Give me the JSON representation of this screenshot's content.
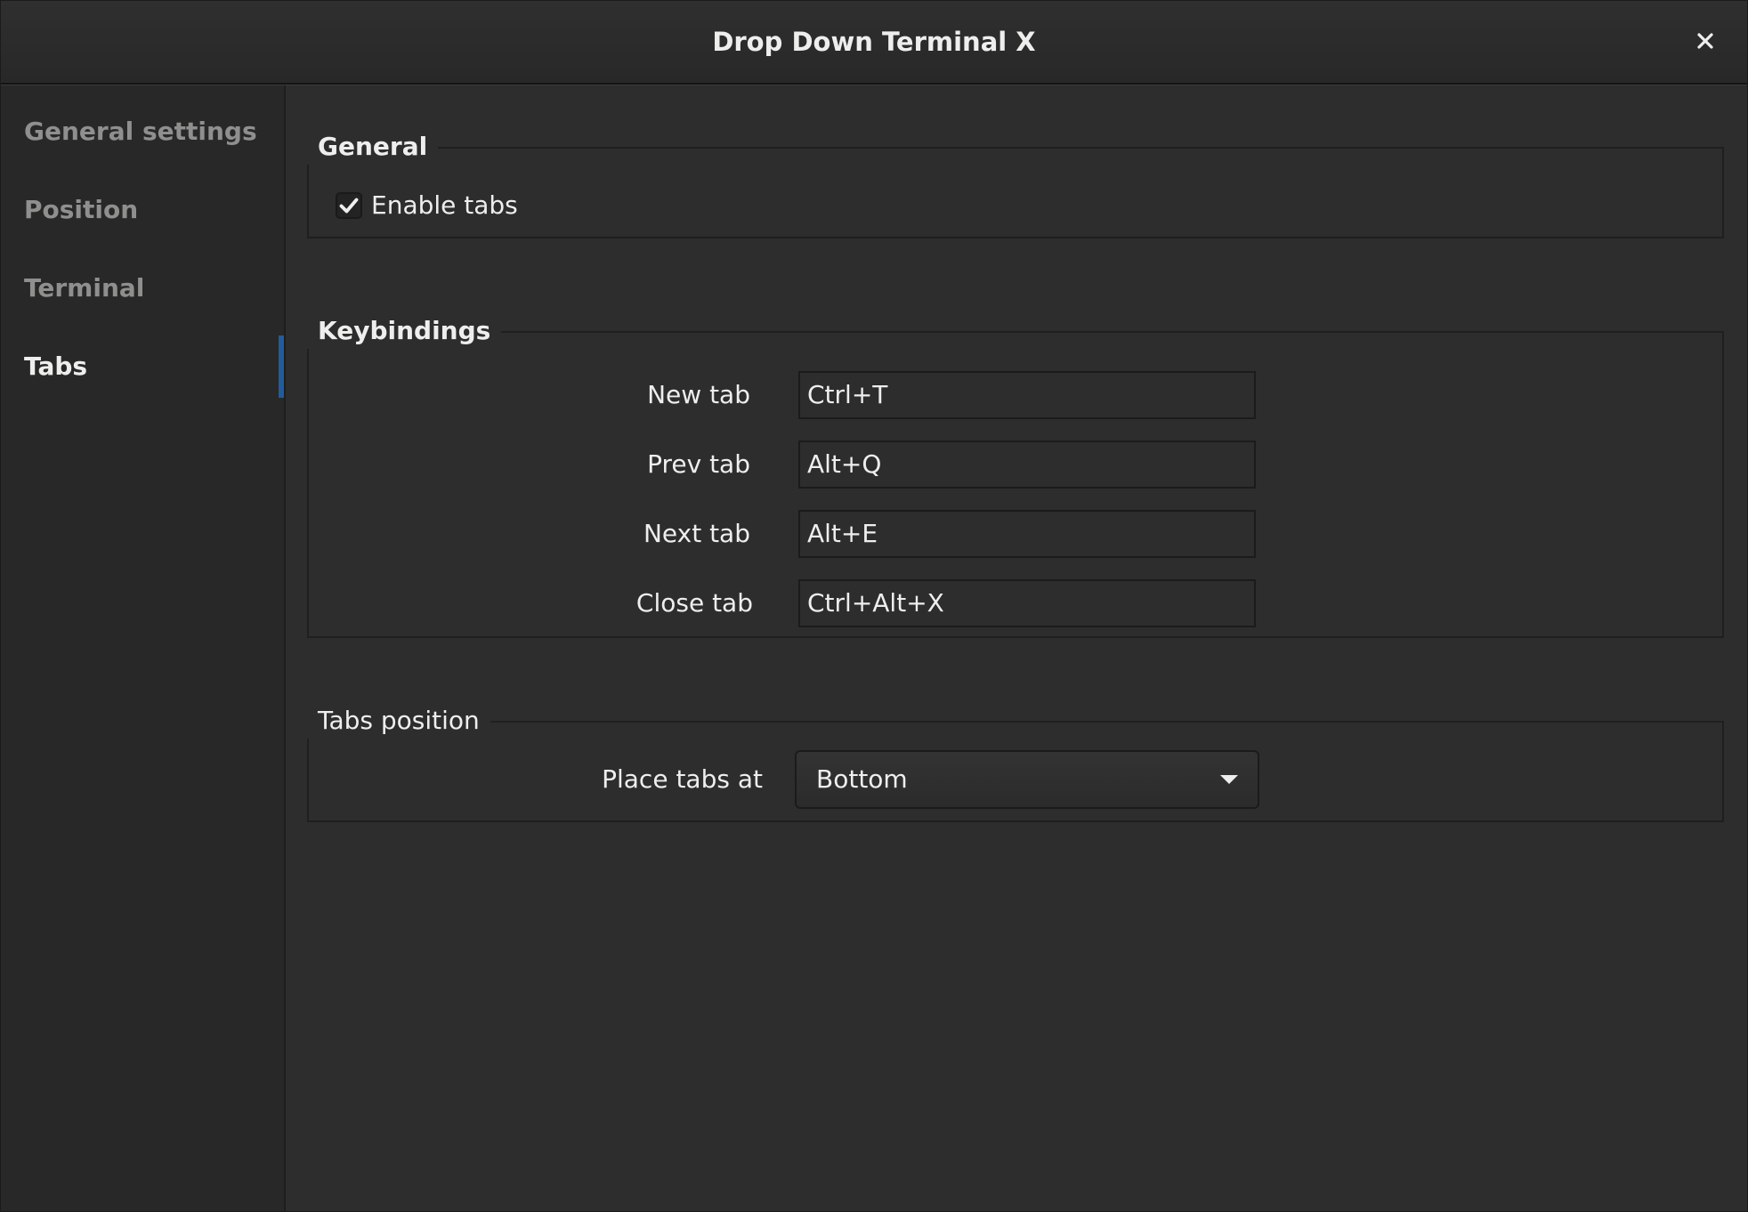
{
  "window": {
    "title": "Drop Down Terminal X"
  },
  "sidebar": {
    "items": [
      {
        "label": "General settings",
        "active": false
      },
      {
        "label": "Position",
        "active": false
      },
      {
        "label": "Terminal",
        "active": false
      },
      {
        "label": "Tabs",
        "active": true
      }
    ]
  },
  "general": {
    "label": "General",
    "enable_tabs": {
      "label": "Enable tabs",
      "checked": true
    }
  },
  "keybindings": {
    "label": "Keybindings",
    "rows": [
      {
        "label": "New tab",
        "value": "Ctrl+T"
      },
      {
        "label": "Prev tab",
        "value": "Alt+Q"
      },
      {
        "label": "Next tab",
        "value": "Alt+E"
      },
      {
        "label": "Close tab",
        "value": "Ctrl+Alt+X"
      }
    ]
  },
  "tabs_position": {
    "label": "Tabs position",
    "place_label": "Place tabs at",
    "selected": "Bottom"
  },
  "colors": {
    "accent": "#215d9c",
    "background": "#2d2d2d",
    "sidebar": "#282828"
  },
  "icons": {
    "close": "close-icon",
    "check": "checkmark-icon",
    "dropdown": "chevron-down-icon"
  }
}
